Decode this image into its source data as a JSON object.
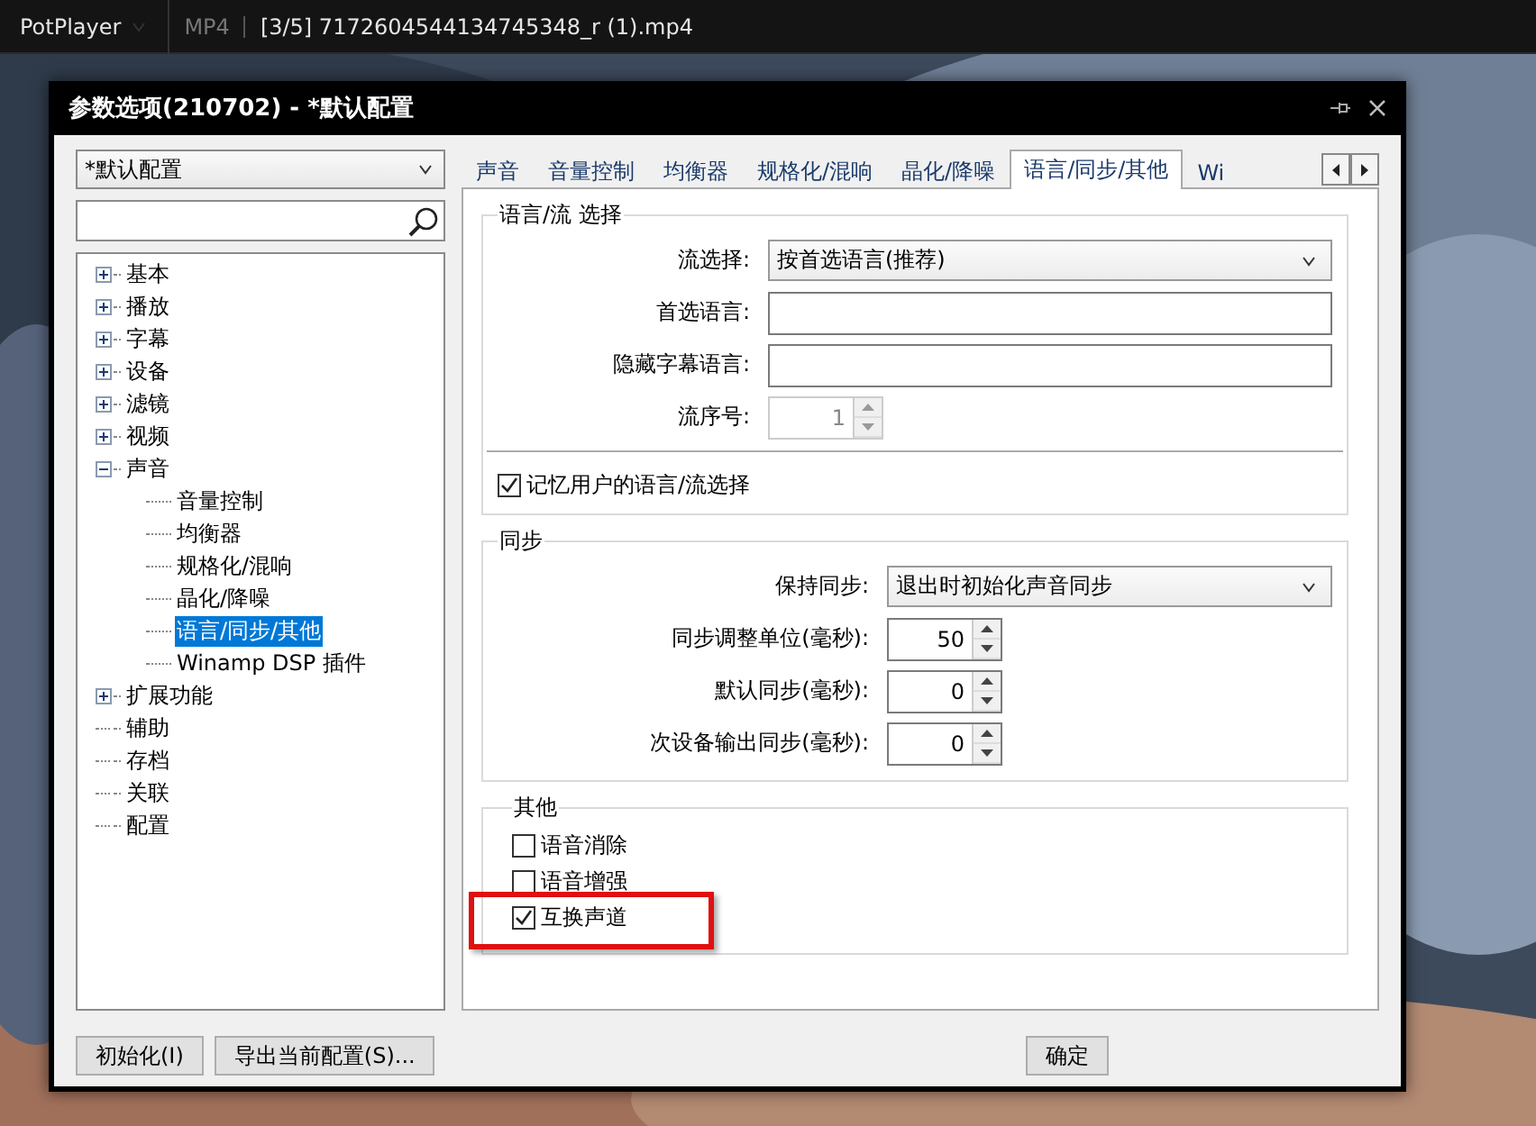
{
  "top_bar": {
    "app_menu": "PotPlayer",
    "format": "MP4",
    "file": "[3/5] 7172604544134745348_r (1).mp4"
  },
  "dialog": {
    "title": "参数选项(210702) - *默认配置",
    "profile_select": {
      "value": "*默认配置"
    },
    "tree": [
      {
        "kind": "branch",
        "label": "基本",
        "expanded": false,
        "selected": false
      },
      {
        "kind": "branch",
        "label": "播放",
        "expanded": false,
        "selected": false
      },
      {
        "kind": "branch",
        "label": "字幕",
        "expanded": false,
        "selected": false
      },
      {
        "kind": "branch",
        "label": "设备",
        "expanded": false,
        "selected": false
      },
      {
        "kind": "branch",
        "label": "滤镜",
        "expanded": false,
        "selected": false
      },
      {
        "kind": "branch",
        "label": "视频",
        "expanded": false,
        "selected": false
      },
      {
        "kind": "branch",
        "label": "声音",
        "expanded": true,
        "selected": false,
        "children": [
          {
            "label": "音量控制",
            "selected": false
          },
          {
            "label": "均衡器",
            "selected": false
          },
          {
            "label": "规格化/混响",
            "selected": false
          },
          {
            "label": "晶化/降噪",
            "selected": false
          },
          {
            "label": "语言/同步/其他",
            "selected": true
          },
          {
            "label": "Winamp DSP 插件",
            "selected": false
          }
        ]
      },
      {
        "kind": "branch",
        "label": "扩展功能",
        "expanded": false,
        "selected": false
      },
      {
        "kind": "leaf",
        "label": "辅助",
        "selected": false
      },
      {
        "kind": "leaf",
        "label": "存档",
        "selected": false
      },
      {
        "kind": "leaf",
        "label": "关联",
        "selected": false
      },
      {
        "kind": "leaf",
        "label": "配置",
        "selected": false
      }
    ],
    "tabs": [
      {
        "label": "声音",
        "selected": false
      },
      {
        "label": "音量控制",
        "selected": false
      },
      {
        "label": "均衡器",
        "selected": false
      },
      {
        "label": "规格化/混响",
        "selected": false
      },
      {
        "label": "晶化/降噪",
        "selected": false
      },
      {
        "label": "语言/同步/其他",
        "selected": true
      },
      {
        "label": "Wi",
        "selected": false
      }
    ],
    "stream_group": {
      "title": "语言/流 选择",
      "fields": [
        {
          "kind": "select",
          "label": "流选择:",
          "value": "按首选语言(推荐)"
        },
        {
          "kind": "text",
          "label": "首选语言:"
        },
        {
          "kind": "text",
          "label": "隐藏字幕语言:"
        },
        {
          "kind": "spin",
          "label": "流序号:",
          "value": "1",
          "disabled": true
        }
      ],
      "checkbox": {
        "label": "记忆用户的语言/流选择",
        "checked": true
      }
    },
    "sync_group": {
      "title": "同步",
      "fields": [
        {
          "kind": "select",
          "label": "保持同步:",
          "value": "退出时初始化声音同步"
        },
        {
          "kind": "spin",
          "label": "同步调整单位(毫秒):",
          "value": "50",
          "disabled": false
        },
        {
          "kind": "spin",
          "label": "默认同步(毫秒):",
          "value": "0",
          "disabled": false
        },
        {
          "kind": "spin",
          "label": "次设备输出同步(毫秒):",
          "value": "0",
          "disabled": false
        }
      ]
    },
    "other_group": {
      "title": "其他",
      "checkboxes": [
        {
          "label": "语音消除",
          "checked": false,
          "highlighted": false
        },
        {
          "label": "语音增强",
          "checked": false,
          "highlighted": false
        },
        {
          "label": "互换声道",
          "checked": true,
          "highlighted": true
        }
      ]
    },
    "footer_left": [
      "初始化(I)",
      "导出当前配置(S)..."
    ],
    "footer_right": [
      "确定"
    ]
  }
}
